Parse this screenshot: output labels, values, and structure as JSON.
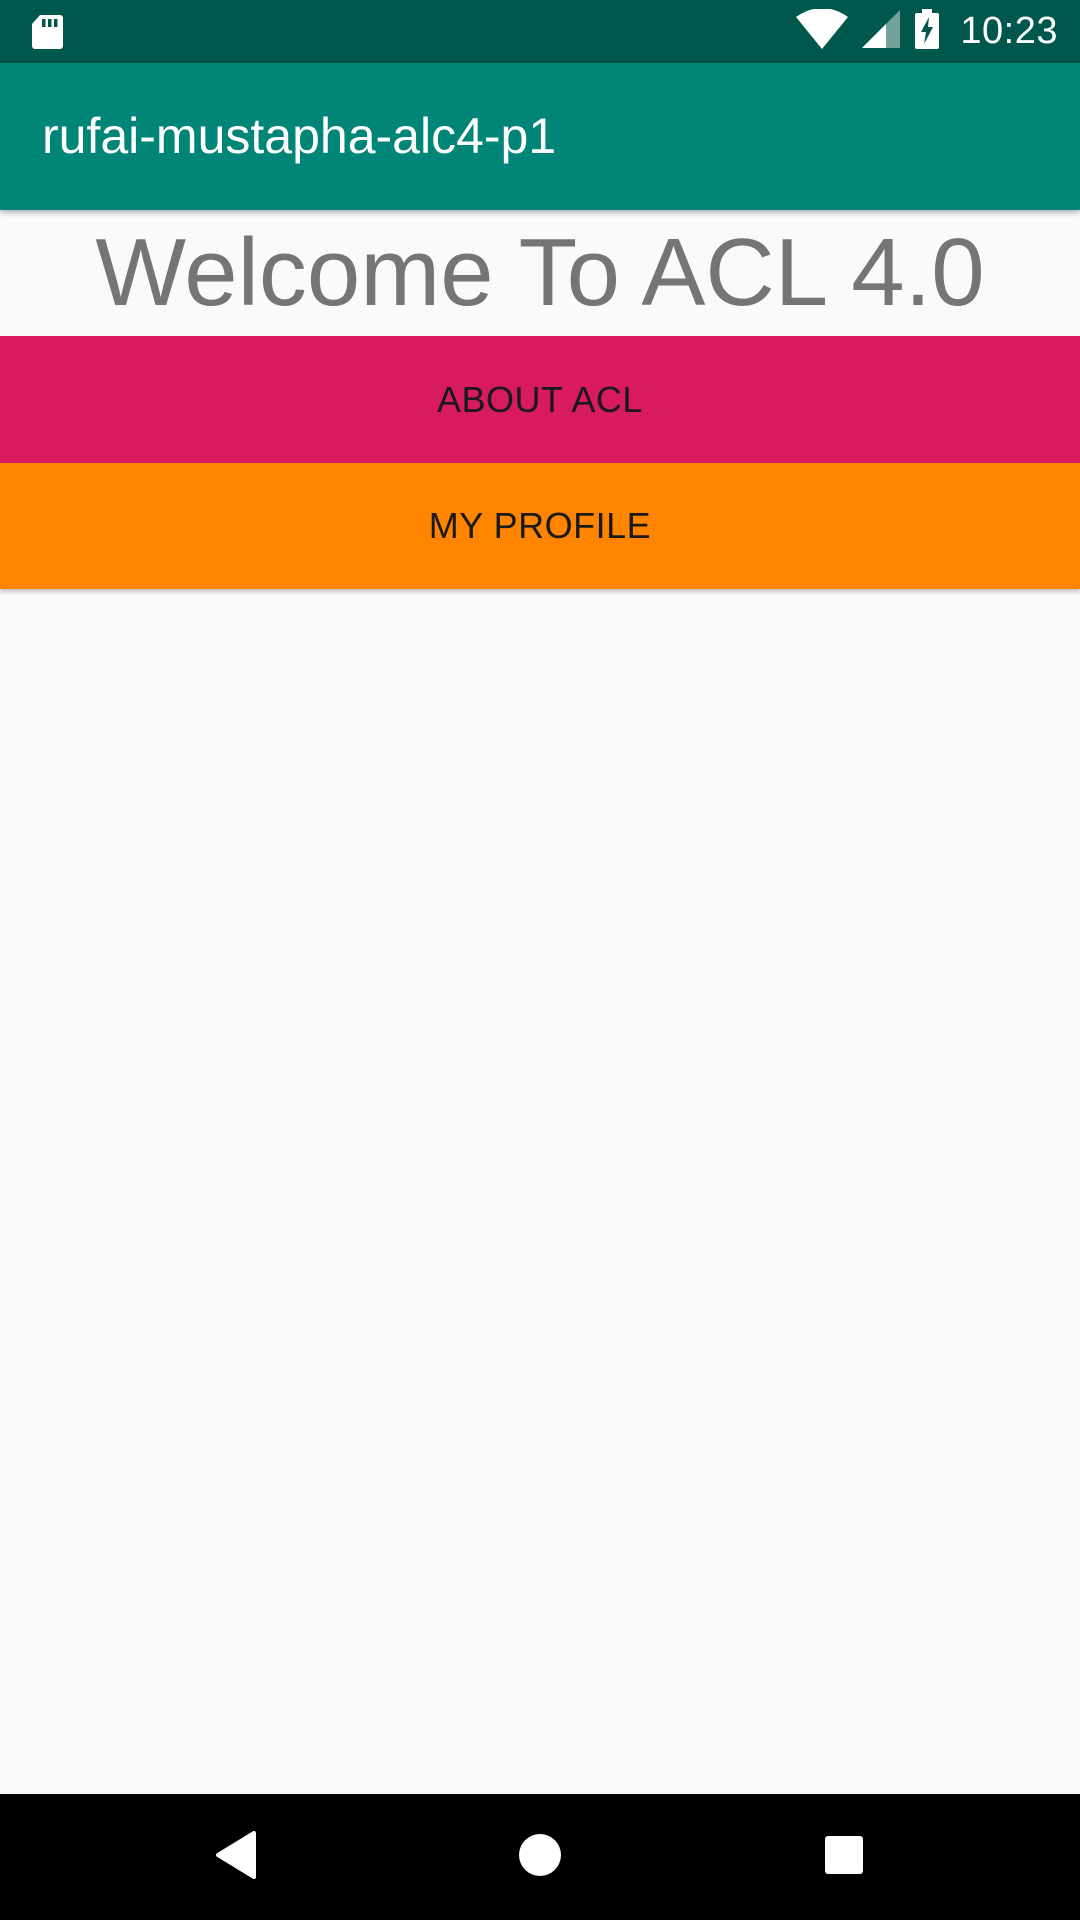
{
  "status_bar": {
    "time": "10:23",
    "icons": [
      "sd-card-icon",
      "wifi-icon",
      "signal-icon",
      "battery-charging-icon"
    ],
    "color": "#00574b"
  },
  "app_bar": {
    "title": "rufai-mustapha-alc4-p1",
    "color": "#008577"
  },
  "main": {
    "welcome_text": "Welcome To ACL 4.0",
    "buttons": [
      {
        "label": "ABOUT ACL",
        "color": "#d81b60"
      },
      {
        "label": "MY PROFILE",
        "color": "#ff8400"
      }
    ]
  },
  "nav_bar": {
    "icons": [
      "back-icon",
      "home-icon",
      "recent-apps-icon"
    ]
  }
}
